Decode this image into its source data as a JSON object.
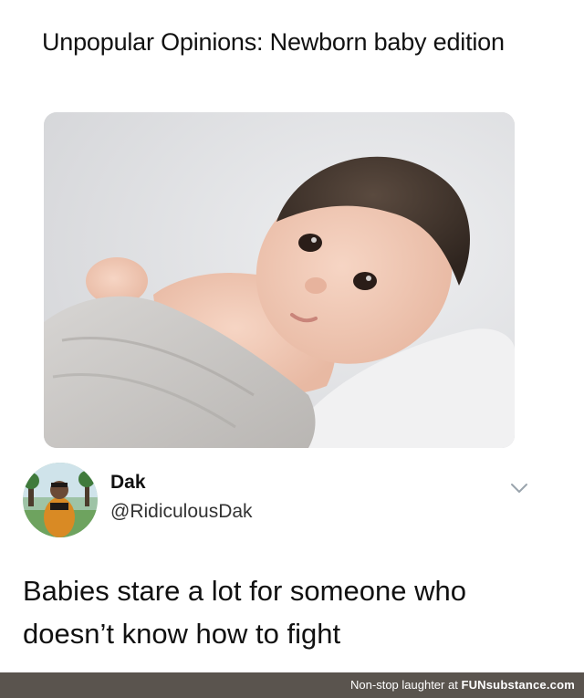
{
  "post": {
    "title": "Unpopular Opinions: Newborn baby edition"
  },
  "tweet": {
    "name": "Dak",
    "handle": "@RidiculousDak",
    "text": "Babies stare a lot for someone who doesn’t know how to fight"
  },
  "footer": {
    "prefix": "Non-stop laughter at ",
    "brand": "FUNsubstance.com"
  },
  "colors": {
    "footer_bg": "#5a544e",
    "text": "#111111"
  },
  "icons": {
    "chevron": "chevron-down-icon"
  }
}
